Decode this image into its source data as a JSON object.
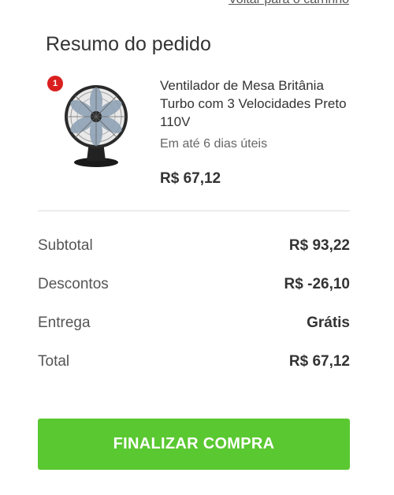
{
  "header": {
    "back_link_label": "Voltar para o carrinho",
    "title": "Resumo do pedido"
  },
  "product": {
    "quantity_badge": "1",
    "name": "Ventilador de Mesa Britânia Turbo com 3 Velocidades Preto 110V",
    "delivery": "Em até 6 dias úteis",
    "price": "R$ 67,12",
    "image_icon": "table-fan"
  },
  "totals": {
    "rows": [
      {
        "label": "Subtotal",
        "value": "R$ 93,22"
      },
      {
        "label": "Descontos",
        "value": "R$ -26,10"
      },
      {
        "label": "Entrega",
        "value": "Grátis"
      },
      {
        "label": "Total",
        "value": "R$ 67,12"
      }
    ]
  },
  "checkout": {
    "button_label": "FINALIZAR COMPRA",
    "button_color": "#5ac831"
  },
  "colors": {
    "badge": "#d9201f",
    "text": "#333333",
    "divider": "#dddddd"
  }
}
